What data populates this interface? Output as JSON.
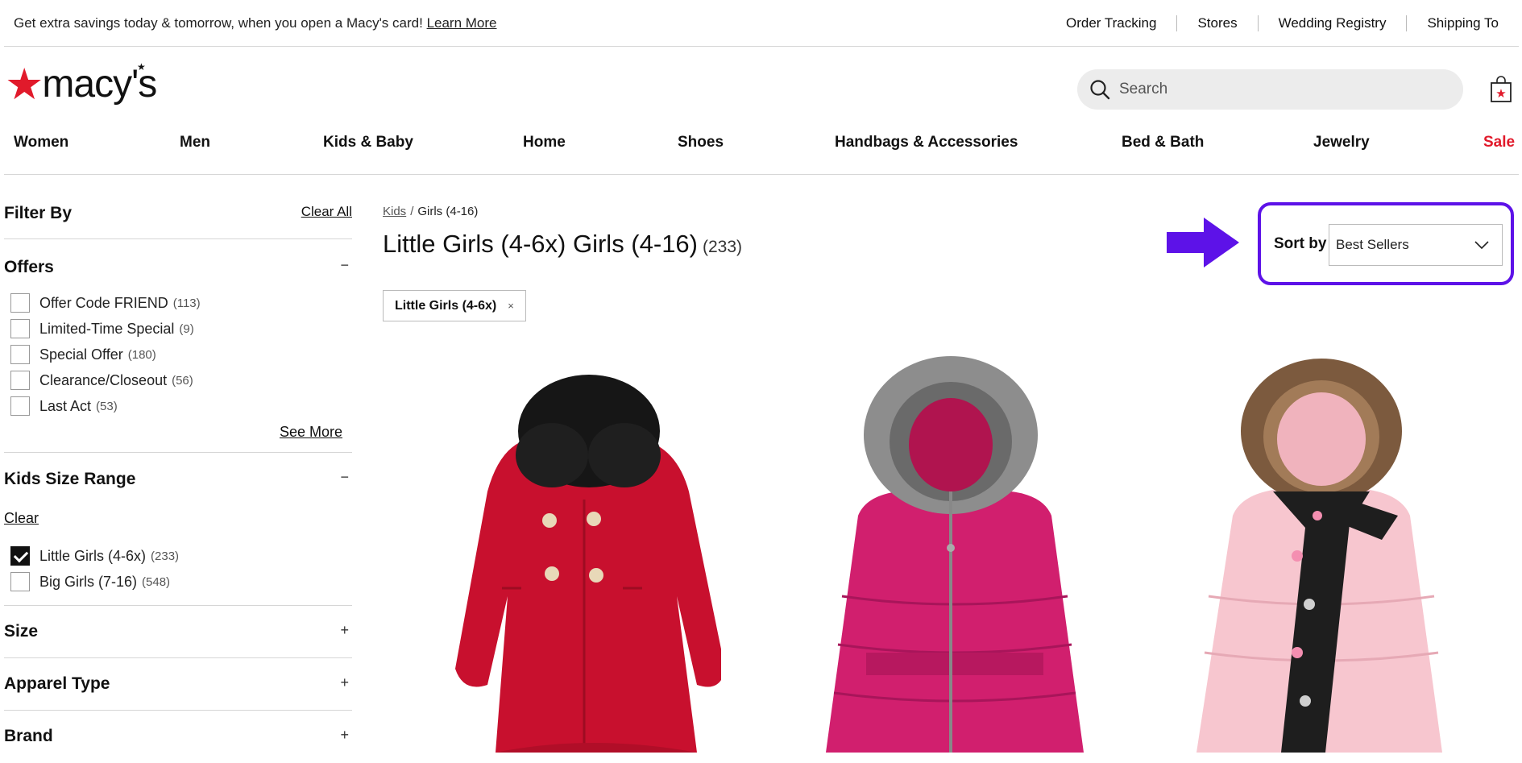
{
  "banner": {
    "promo_text": "Get extra savings today & tomorrow, when you open a Macy's card!",
    "promo_link": "Learn More",
    "links": [
      "Order Tracking",
      "Stores",
      "Wedding Registry",
      "Shipping To"
    ]
  },
  "header": {
    "logo_text": "macy's",
    "search_placeholder": "Search",
    "brand_color": "#e11a2b"
  },
  "nav": {
    "items": [
      "Women",
      "Men",
      "Kids & Baby",
      "Home",
      "Shoes",
      "Handbags & Accessories",
      "Bed & Bath",
      "Jewelry",
      "Sale"
    ]
  },
  "filters": {
    "title": "Filter By",
    "clear_all": "Clear All",
    "offers": {
      "title": "Offers",
      "toggle": "−",
      "options": [
        {
          "label": "Offer Code FRIEND",
          "count": "(113)"
        },
        {
          "label": "Limited-Time Special",
          "count": "(9)"
        },
        {
          "label": "Special Offer",
          "count": "(180)"
        },
        {
          "label": "Clearance/Closeout",
          "count": "(56)"
        },
        {
          "label": "Last Act",
          "count": "(53)"
        }
      ],
      "see_more": "See More"
    },
    "kids_size": {
      "title": "Kids Size Range",
      "toggle": "−",
      "clear": "Clear",
      "options": [
        {
          "label": "Little Girls (4-6x)",
          "count": "(233)",
          "checked": true
        },
        {
          "label": "Big Girls (7-16)",
          "count": "(548)",
          "checked": false
        }
      ]
    },
    "size": {
      "title": "Size",
      "toggle": "+"
    },
    "apparel": {
      "title": "Apparel Type",
      "toggle": "+"
    },
    "brand": {
      "title": "Brand",
      "toggle": "+"
    }
  },
  "main": {
    "breadcrumb": {
      "link": "Kids",
      "sep": "/",
      "current": "Girls (4-16)"
    },
    "title": "Little Girls (4-6x) Girls (4-16)",
    "count": "(233)",
    "chip": {
      "label": "Little Girls (4-6x)",
      "remove": "×"
    },
    "sort": {
      "label": "Sort by",
      "value": "Best Sellers",
      "highlight_color": "#5d12e8"
    }
  },
  "products": [
    {
      "icon": "red-wool-coat-image"
    },
    {
      "icon": "pink-puffer-jacket-image"
    },
    {
      "icon": "light-pink-puffer-with-scarf-image"
    }
  ]
}
